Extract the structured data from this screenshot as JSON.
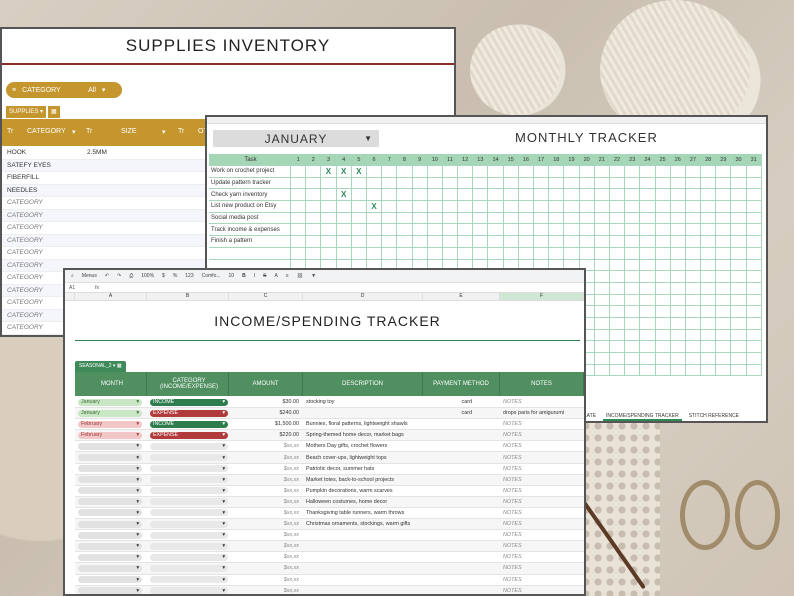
{
  "supplies": {
    "title": "SUPPLIES INVENTORY",
    "filter_label": "CATEGORY",
    "filter_value": "All",
    "tab_label": "SUPPLIES",
    "headers": [
      "CATEGORY",
      "SIZE",
      "OTH"
    ],
    "rows": [
      {
        "cat": "HOOK",
        "size": "2.5MM"
      },
      {
        "cat": "SATEFY EYES",
        "size": ""
      },
      {
        "cat": "FIBERFILL",
        "size": ""
      },
      {
        "cat": "NEEDLES",
        "size": ""
      },
      {
        "cat": "CATEGORY",
        "size": ""
      },
      {
        "cat": "CATEGORY",
        "size": ""
      },
      {
        "cat": "CATEGORY",
        "size": ""
      },
      {
        "cat": "CATEGORY",
        "size": ""
      },
      {
        "cat": "CATEGORY",
        "size": ""
      },
      {
        "cat": "CATEGORY",
        "size": ""
      },
      {
        "cat": "CATEGORY",
        "size": ""
      },
      {
        "cat": "CATEGORY",
        "size": ""
      },
      {
        "cat": "CATEGORY",
        "size": ""
      },
      {
        "cat": "CATEGORY",
        "size": ""
      },
      {
        "cat": "CATEGORY",
        "size": ""
      },
      {
        "cat": "CATEGORY",
        "size": ""
      }
    ]
  },
  "monthly": {
    "month": "JANUARY",
    "title": "MONTHLY TRACKER",
    "task_header": "Task",
    "days": [
      "1",
      "2",
      "3",
      "4",
      "5",
      "6",
      "7",
      "8",
      "9",
      "10",
      "11",
      "12",
      "13",
      "14",
      "15",
      "16",
      "17",
      "18",
      "19",
      "20",
      "21",
      "22",
      "23",
      "24",
      "25",
      "26",
      "27",
      "28",
      "29",
      "30",
      "31"
    ],
    "tasks": [
      {
        "name": "Work on crochet project",
        "done": [
          3,
          4,
          5
        ]
      },
      {
        "name": "Update pattern tracker",
        "done": []
      },
      {
        "name": "Check yarn inventory",
        "done": [
          4
        ]
      },
      {
        "name": "List new product on Etsy",
        "done": [
          6
        ]
      },
      {
        "name": "Social media post",
        "done": []
      },
      {
        "name": "Track income & expenses",
        "done": []
      },
      {
        "name": "Finish a pattern",
        "done": []
      }
    ],
    "mark": "X",
    "tabs": [
      "TEMPLATE",
      "INCOME/SPENDING TRACKER",
      "STITCH REFERENCE"
    ]
  },
  "income": {
    "toolbar": [
      "Menus",
      "100%",
      "$",
      "%",
      "123",
      "Comfo...",
      "10"
    ],
    "fx_label": "fx",
    "columns": [
      "A",
      "B",
      "C",
      "D",
      "E",
      "F"
    ],
    "title": "INCOME/SPENDING TRACKER",
    "tab_label": "SEASONAL_2",
    "headers": [
      "MONTH",
      "CATEGORY (INCOME/EXPENSE)",
      "AMOUNT",
      "DESCRIPTION",
      "PAYMENT METHOD",
      "NOTES"
    ],
    "rows": [
      {
        "month": "January",
        "mtype": "jan",
        "cat": "INCOME",
        "ctype": "income",
        "amt": "$30.00",
        "desc": "stocking toy",
        "pay": "card",
        "notes": "NOTES"
      },
      {
        "month": "January",
        "mtype": "jan",
        "cat": "EXPENSE",
        "ctype": "expense",
        "amt": "$240.00",
        "desc": "",
        "pay": "card",
        "notes": "drops paris for amigurumi"
      },
      {
        "month": "February",
        "mtype": "feb",
        "cat": "INCOME",
        "ctype": "income",
        "amt": "$1,500.00",
        "desc": "Bunnies, floral patterns, lightweight shawls",
        "pay": "",
        "notes": "NOTES"
      },
      {
        "month": "February",
        "mtype": "feb",
        "cat": "EXPENSE",
        "ctype": "expense",
        "amt": "$220.00",
        "desc": "Spring-themed home decor, market bags",
        "pay": "",
        "notes": "NOTES"
      },
      {
        "month": "",
        "mtype": "blank",
        "cat": "",
        "ctype": "blankc",
        "amt": "$xx,xx",
        "desc": "Mothers Day gifts, crochet flowers",
        "pay": "",
        "notes": "NOTES"
      },
      {
        "month": "",
        "mtype": "blank",
        "cat": "",
        "ctype": "blankc",
        "amt": "$xx,xx",
        "desc": "Beach cover-ups, lightweight tops",
        "pay": "",
        "notes": "NOTES"
      },
      {
        "month": "",
        "mtype": "blank",
        "cat": "",
        "ctype": "blankc",
        "amt": "$xx,xx",
        "desc": "Patriotic decor, summer hats",
        "pay": "",
        "notes": "NOTES"
      },
      {
        "month": "",
        "mtype": "blank",
        "cat": "",
        "ctype": "blankc",
        "amt": "$xx,xx",
        "desc": "Market totes, back-to-school projects",
        "pay": "",
        "notes": "NOTES"
      },
      {
        "month": "",
        "mtype": "blank",
        "cat": "",
        "ctype": "blankc",
        "amt": "$xx,xx",
        "desc": "Pumpkin decorations, warm scarves",
        "pay": "",
        "notes": "NOTES"
      },
      {
        "month": "",
        "mtype": "blank",
        "cat": "",
        "ctype": "blankc",
        "amt": "$xx,xx",
        "desc": "Halloween costumes, home decor",
        "pay": "",
        "notes": "NOTES"
      },
      {
        "month": "",
        "mtype": "blank",
        "cat": "",
        "ctype": "blankc",
        "amt": "$xx,xx",
        "desc": "Thanksgiving table runners, warm throws",
        "pay": "",
        "notes": "NOTES"
      },
      {
        "month": "",
        "mtype": "blank",
        "cat": "",
        "ctype": "blankc",
        "amt": "$xx,xx",
        "desc": "Christmas ornaments, stockings, warm gifts",
        "pay": "",
        "notes": "NOTES"
      },
      {
        "month": "",
        "mtype": "blank",
        "cat": "",
        "ctype": "blankc",
        "amt": "$xx,xx",
        "desc": "",
        "pay": "",
        "notes": "NOTES"
      },
      {
        "month": "",
        "mtype": "blank",
        "cat": "",
        "ctype": "blankc",
        "amt": "$xx,xx",
        "desc": "",
        "pay": "",
        "notes": "NOTES"
      },
      {
        "month": "",
        "mtype": "blank",
        "cat": "",
        "ctype": "blankc",
        "amt": "$xx,xx",
        "desc": "",
        "pay": "",
        "notes": "NOTES"
      },
      {
        "month": "",
        "mtype": "blank",
        "cat": "",
        "ctype": "blankc",
        "amt": "$xx,xx",
        "desc": "",
        "pay": "",
        "notes": "NOTES"
      },
      {
        "month": "",
        "mtype": "blank",
        "cat": "",
        "ctype": "blankc",
        "amt": "$xx,xx",
        "desc": "",
        "pay": "",
        "notes": "NOTES"
      },
      {
        "month": "",
        "mtype": "blank",
        "cat": "",
        "ctype": "blankc",
        "amt": "$xx,xx",
        "desc": "",
        "pay": "",
        "notes": "NOTES"
      }
    ]
  }
}
